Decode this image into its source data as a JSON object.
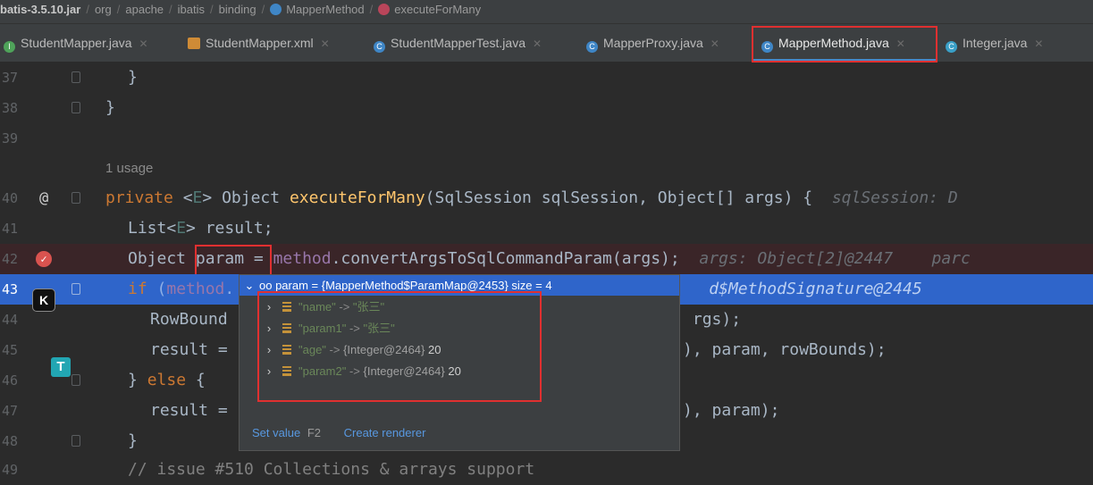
{
  "breadcrumb": {
    "items": [
      "batis-3.5.10.jar",
      "org",
      "apache",
      "ibatis",
      "binding",
      "MapperMethod",
      "executeForMany"
    ]
  },
  "tabs": [
    {
      "label": "StudentMapper.java",
      "icon": "interface-icon"
    },
    {
      "label": "StudentMapper.xml",
      "icon": "xml-file-icon"
    },
    {
      "label": "StudentMapperTest.java",
      "icon": "class-icon"
    },
    {
      "label": "MapperProxy.java",
      "icon": "class-icon"
    },
    {
      "label": "MapperMethod.java",
      "icon": "class-icon",
      "active": true
    },
    {
      "label": "Integer.java",
      "icon": "class-icon"
    }
  ],
  "editor": {
    "usage_hint": "1 usage",
    "line_numbers": [
      "37",
      "38",
      "39",
      "40",
      "41",
      "42",
      "43",
      "44",
      "45",
      "46",
      "47",
      "48",
      "49"
    ],
    "inline_hint_40": "sqlSession: D",
    "inline_hint_42": "args: Object[2]@2447    parc",
    "inline_hint_43": "d$MethodSignature@2445"
  },
  "debug_popup": {
    "header": "oo param = {MapperMethod$ParamMap@2453}  size = 4",
    "entries": [
      {
        "key": "\"name\"",
        "arrow": "->",
        "value": "\"张三\"",
        "value_type": "string"
      },
      {
        "key": "\"param1\"",
        "arrow": "->",
        "value": "\"张三\"",
        "value_type": "string"
      },
      {
        "key": "\"age\"",
        "arrow": "->",
        "obj": "{Integer@2464}",
        "value": "20",
        "value_type": "number"
      },
      {
        "key": "\"param2\"",
        "arrow": "->",
        "obj": "{Integer@2464}",
        "value": "20",
        "value_type": "number"
      }
    ],
    "footer": {
      "set_value": "Set value",
      "set_value_key": "F2",
      "create_renderer": "Create renderer"
    }
  },
  "colors": {
    "editor_bg": "#2b2b2b",
    "selection_blue": "#2f65ca",
    "breakpoint_row": "#3a2528",
    "highlight_red": "#e03030"
  }
}
